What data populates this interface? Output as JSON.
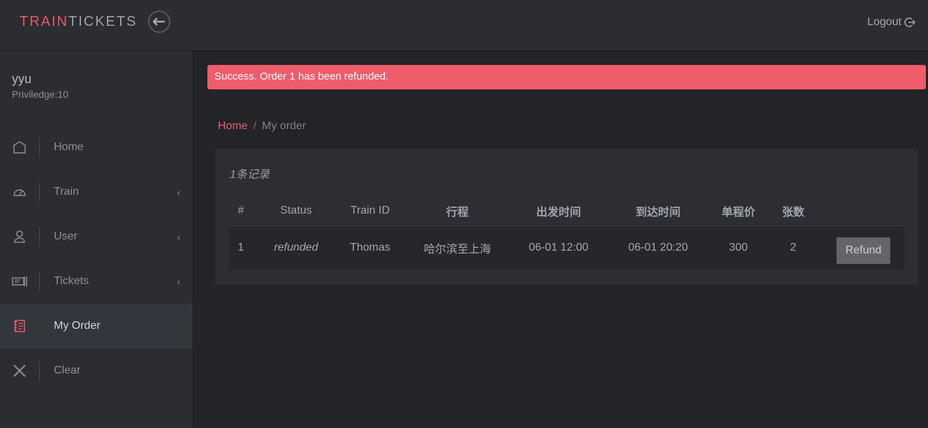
{
  "header": {
    "brand_part1": "TRAIN",
    "brand_part2": "TICKETS",
    "logout_label": "Logout"
  },
  "user": {
    "name": "yyu",
    "privilege": "Priviledge:10"
  },
  "sidebar": {
    "items": [
      {
        "label": "Home",
        "icon": "home-icon",
        "caret": false
      },
      {
        "label": "Train",
        "icon": "dashboard-icon",
        "caret": true
      },
      {
        "label": "User",
        "icon": "user-icon",
        "caret": true
      },
      {
        "label": "Tickets",
        "icon": "ticket-icon",
        "caret": true
      },
      {
        "label": "My Order",
        "icon": "order-icon",
        "caret": false,
        "active": true
      },
      {
        "label": "Clear",
        "icon": "clear-icon",
        "caret": false
      }
    ]
  },
  "alert": {
    "message": "Success. Order 1 has been refunded."
  },
  "breadcrumb": {
    "home": "Home",
    "separator": "/",
    "current": "My order"
  },
  "orders": {
    "record_count": "1条记录",
    "columns": [
      "#",
      "Status",
      "Train ID",
      "行程",
      "出发时间",
      "到达时间",
      "单程价",
      "张数",
      ""
    ],
    "rows": [
      {
        "index": "1",
        "status": "refunded",
        "train_id": "Thomas",
        "route": "哈尔滨至上海",
        "depart": "06-01 12:00",
        "arrive": "06-01 20:20",
        "price": "300",
        "count": "2",
        "action": "Refund"
      }
    ]
  },
  "colors": {
    "accent": "#ef5d6c",
    "background": "#222428",
    "panel": "#2b2d32"
  }
}
